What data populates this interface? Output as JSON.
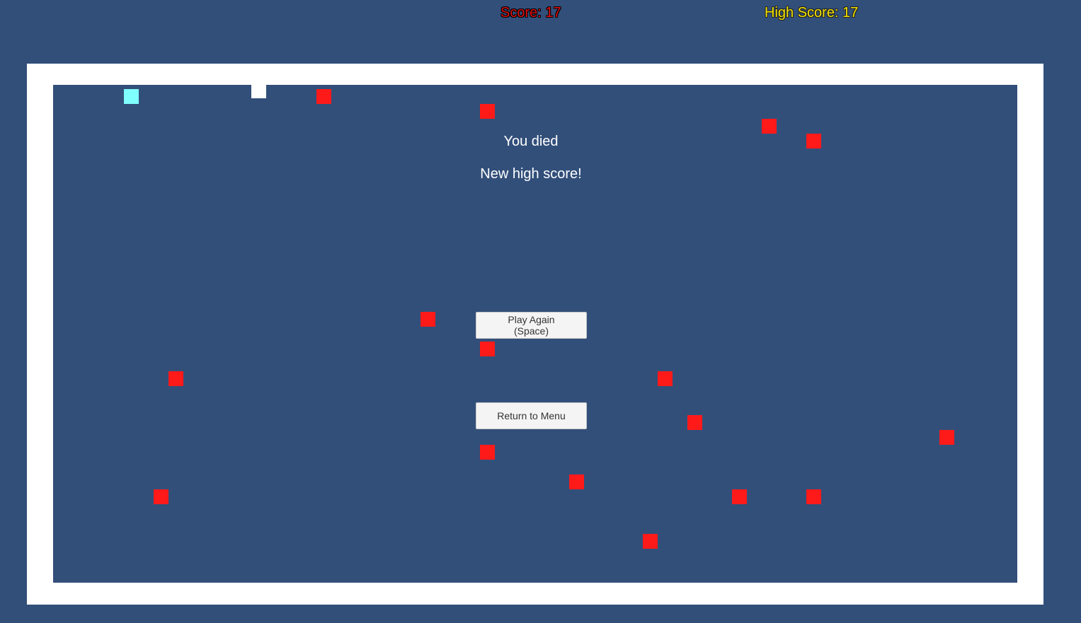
{
  "hud": {
    "score": "Score: 17",
    "high_score": "High Score: 17"
  },
  "messages": {
    "death": "You died",
    "new_high_score": "New high score!"
  },
  "buttons": {
    "play_again_line1": "Play Again",
    "play_again_line2": "(Space)",
    "return_to_menu": "Return to Menu"
  },
  "colors": {
    "background": "#324f7a",
    "wall": "#ffffff",
    "enemy": "#ff1a1a",
    "player": "#80ffff",
    "pickup": "#ffffff",
    "score_text": "#e01010",
    "high_score_text": "#f2e300"
  }
}
